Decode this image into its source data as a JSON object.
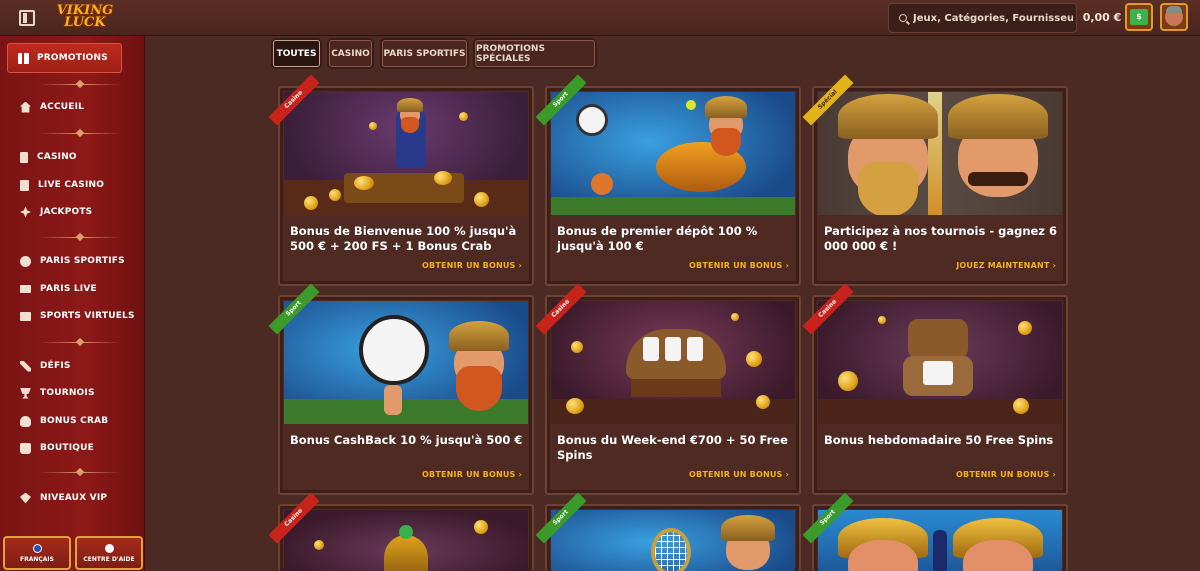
{
  "header": {
    "logo_line1": "VIKING",
    "logo_line2": "LUCK",
    "search_placeholder": "Jeux, Catégories, Fournisseurs",
    "balance": "0,00 €",
    "wallet_label": "$"
  },
  "sidebar": {
    "promo": "PROMOTIONS",
    "items": [
      {
        "label": "ACCUEIL"
      },
      {
        "label": "CASINO"
      },
      {
        "label": "LIVE CASINO"
      },
      {
        "label": "JACKPOTS"
      },
      {
        "label": "PARIS SPORTIFS"
      },
      {
        "label": "PARIS LIVE"
      },
      {
        "label": "SPORTS VIRTUELS"
      },
      {
        "label": "DÉFIS"
      },
      {
        "label": "TOURNOIS"
      },
      {
        "label": "BONUS CRAB"
      },
      {
        "label": "BOUTIQUE"
      },
      {
        "label": "NIVEAUX VIP"
      }
    ],
    "language": "FRANÇAIS",
    "help": "CENTRE D'AIDE"
  },
  "tabs": [
    {
      "label": "TOUTES",
      "active": true
    },
    {
      "label": "CASINO"
    },
    {
      "label": "PARIS SPORTIFS"
    },
    {
      "label": "PROMOTIONS SPÉCIALES"
    }
  ],
  "cards": [
    {
      "tag": "Casino",
      "title": "Bonus de Bienvenue 100 % jusqu'à 500 € + 200 FS + 1 Bonus Crab",
      "cta": "OBTENIR UN BONUS"
    },
    {
      "tag": "Sport",
      "title": "Bonus de premier dépôt 100 % jusqu'à 100 €",
      "cta": "OBTENIR UN BONUS"
    },
    {
      "tag": "Spécial",
      "title": "Participez à nos tournois - gagnez 6 000 000 € !",
      "cta": "JOUEZ MAINTENANT"
    },
    {
      "tag": "Sport",
      "title": "Bonus CashBack 10 % jusqu'à 500 €",
      "cta": "OBTENIR UN BONUS"
    },
    {
      "tag": "Casino",
      "title": "Bonus du Week-end €700 + 50 Free Spins",
      "cta": "OBTENIR UN BONUS"
    },
    {
      "tag": "Casino",
      "title": "Bonus hebdomadaire 50 Free Spins",
      "cta": "OBTENIR UN BONUS"
    },
    {
      "tag": "Casino"
    },
    {
      "tag": "Sport"
    },
    {
      "tag": "Sport"
    }
  ],
  "colors": {
    "accent": "#f5b21a",
    "sidebar": "#8e1818",
    "background": "#4a2a22"
  }
}
